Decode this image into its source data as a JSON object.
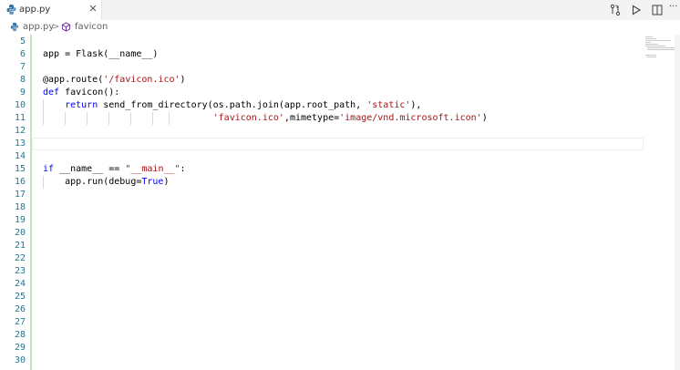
{
  "tab": {
    "label": "app.py",
    "close_glyph": "✕",
    "icon": "python-file-icon"
  },
  "editor_actions": {
    "icons": [
      "source-control-compare-icon",
      "run-icon",
      "split-editor-icon",
      "more-actions-icon"
    ],
    "more_glyph": "···"
  },
  "breadcrumb": {
    "file": "app.py",
    "separator": ">",
    "symbol": "favicon",
    "symbol_icon": "symbol-method-icon"
  },
  "editor": {
    "lines": [
      {
        "n": "5",
        "text": ""
      },
      {
        "n": "6",
        "text": "app = Flask(__name__)"
      },
      {
        "n": "7",
        "text": ""
      },
      {
        "n": "8",
        "text": "@app.route('/favicon.ico')"
      },
      {
        "n": "9",
        "text": "def favicon():"
      },
      {
        "n": "10",
        "text": "    return send_from_directory(os.path.join(app.root_path, 'static'),"
      },
      {
        "n": "11",
        "text": "                               'favicon.ico',mimetype='image/vnd.microsoft.icon')"
      },
      {
        "n": "12",
        "text": ""
      },
      {
        "n": "13",
        "text": ""
      },
      {
        "n": "14",
        "text": ""
      },
      {
        "n": "15",
        "text": "if __name__ == \"__main__\":"
      },
      {
        "n": "16",
        "text": "    app.run(debug=True)"
      },
      {
        "n": "17",
        "text": ""
      },
      {
        "n": "18",
        "text": ""
      },
      {
        "n": "19",
        "text": ""
      },
      {
        "n": "20",
        "text": ""
      },
      {
        "n": "21",
        "text": ""
      },
      {
        "n": "22",
        "text": ""
      },
      {
        "n": "23",
        "text": ""
      },
      {
        "n": "24",
        "text": ""
      },
      {
        "n": "25",
        "text": ""
      },
      {
        "n": "26",
        "text": ""
      },
      {
        "n": "27",
        "text": ""
      },
      {
        "n": "28",
        "text": ""
      },
      {
        "n": "29",
        "text": ""
      },
      {
        "n": "30",
        "text": ""
      }
    ],
    "tokens": {
      "kw_return": "return",
      "kw_def": "def",
      "kw_if": "if",
      "kw_true": "True",
      "str_route": "'/favicon.ico'",
      "str_static": "'static'",
      "str_favicon": "'favicon.ico'",
      "str_mime": "'image/vnd.microsoft.icon'",
      "str_main": "\"__main__\""
    },
    "current_line": "13"
  },
  "colors": {
    "line_number": "#237893",
    "keyword": "#0000ff",
    "string": "#a31515",
    "modified_gutter": "#c2e4c0",
    "python_icon": "#3572a5"
  }
}
